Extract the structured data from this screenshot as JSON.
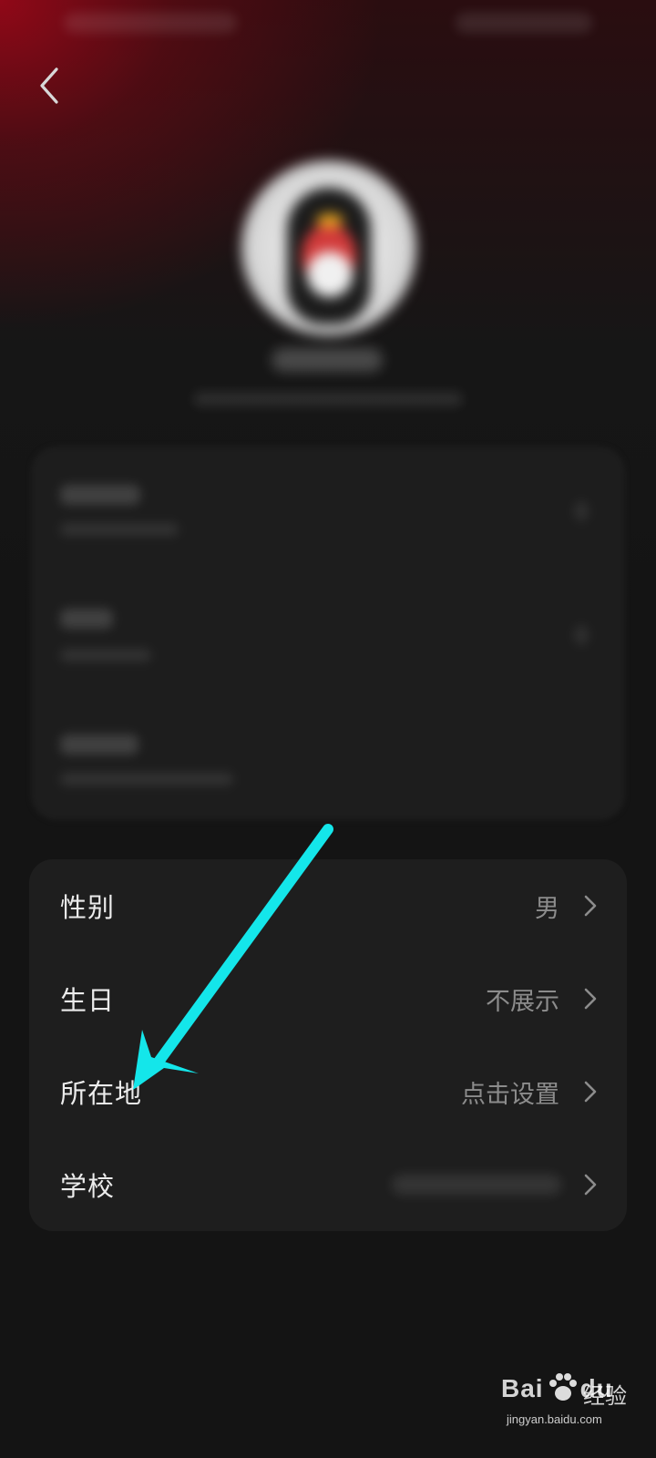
{
  "info_rows": [
    {
      "label": "性别",
      "value": "男"
    },
    {
      "label": "生日",
      "value": "不展示"
    },
    {
      "label": "所在地",
      "value": "点击设置"
    },
    {
      "label": "学校",
      "value": ""
    }
  ],
  "watermark": {
    "brand_left": "Bai",
    "brand_right": "du",
    "brand_cn": "经验",
    "url": "jingyan.baidu.com"
  },
  "colors": {
    "annotation_arrow": "#14e6ea",
    "accent_glow": "#96081a"
  },
  "icons": {
    "back": "chevron-left-icon",
    "row_arrow": "chevron-right-icon"
  }
}
